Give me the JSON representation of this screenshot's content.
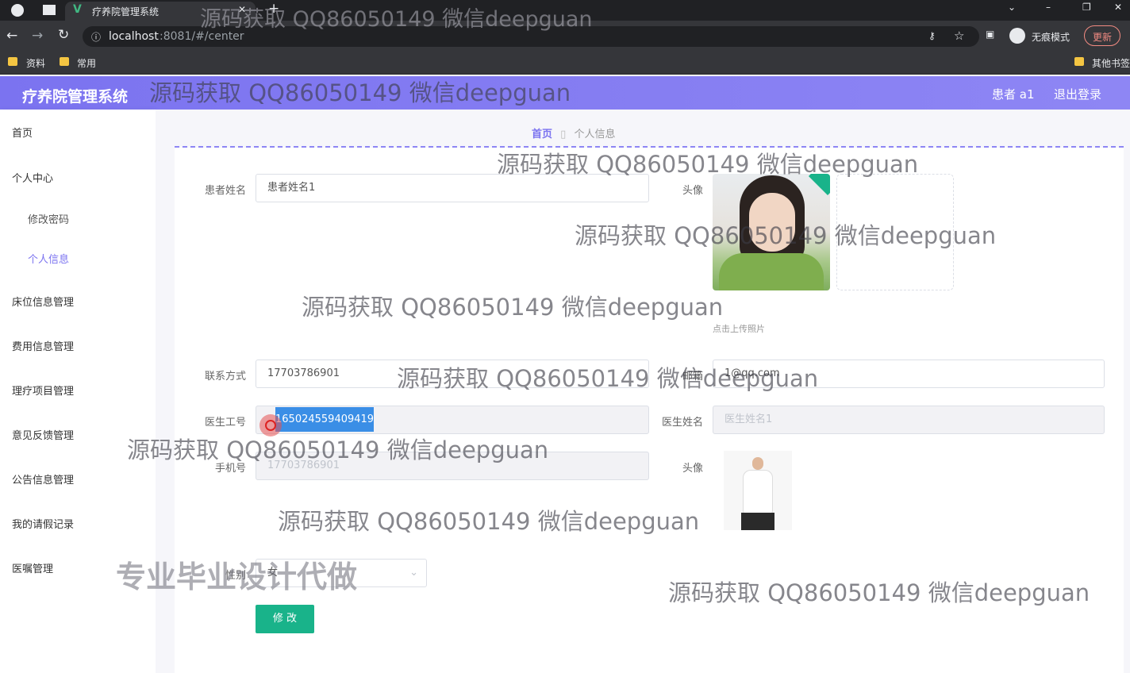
{
  "browser": {
    "tab_title": "疗养院管理系统",
    "url_host": "localhost",
    "url_rest": ":8081/#/center",
    "incognito_label": "无痕模式",
    "update_label": "更新",
    "bookmarks": [
      "资料",
      "常用"
    ],
    "other_bookmarks": "其他书签"
  },
  "header": {
    "title": "疗养院管理系统",
    "user": "患者 a1",
    "logout": "退出登录"
  },
  "sidebar": {
    "items": [
      "首页",
      "个人中心",
      "修改密码",
      "个人信息",
      "床位信息管理",
      "费用信息管理",
      "理疗项目管理",
      "意见反馈管理",
      "公告信息管理",
      "我的请假记录",
      "医嘱管理"
    ]
  },
  "breadcrumb": {
    "home": "首页",
    "current": "个人信息"
  },
  "form": {
    "patient_name_label": "患者姓名",
    "patient_name_value": "患者姓名1",
    "avatar_label": "头像",
    "upload_hint": "点击上传照片",
    "contact_label": "联系方式",
    "contact_value": "17703786901",
    "email_label": "邮箱",
    "email_value": "1@qq.com",
    "doctor_id_label": "医生工号",
    "doctor_id_value": "165024559409419",
    "doctor_name_label": "医生姓名",
    "doctor_name_value": "医生姓名1",
    "phone_label": "手机号",
    "phone_value": "17703786901",
    "doctor_avatar_label": "头像",
    "gender_label": "性别",
    "gender_value": "女",
    "submit_label": "修 改"
  },
  "watermarks": [
    "源码获取 QQ86050149 微信deepguan",
    "专业毕业设计代做"
  ],
  "colors": {
    "accent": "#7b73f0",
    "submit": "#19b38a",
    "selection": "#3a8ee6"
  }
}
